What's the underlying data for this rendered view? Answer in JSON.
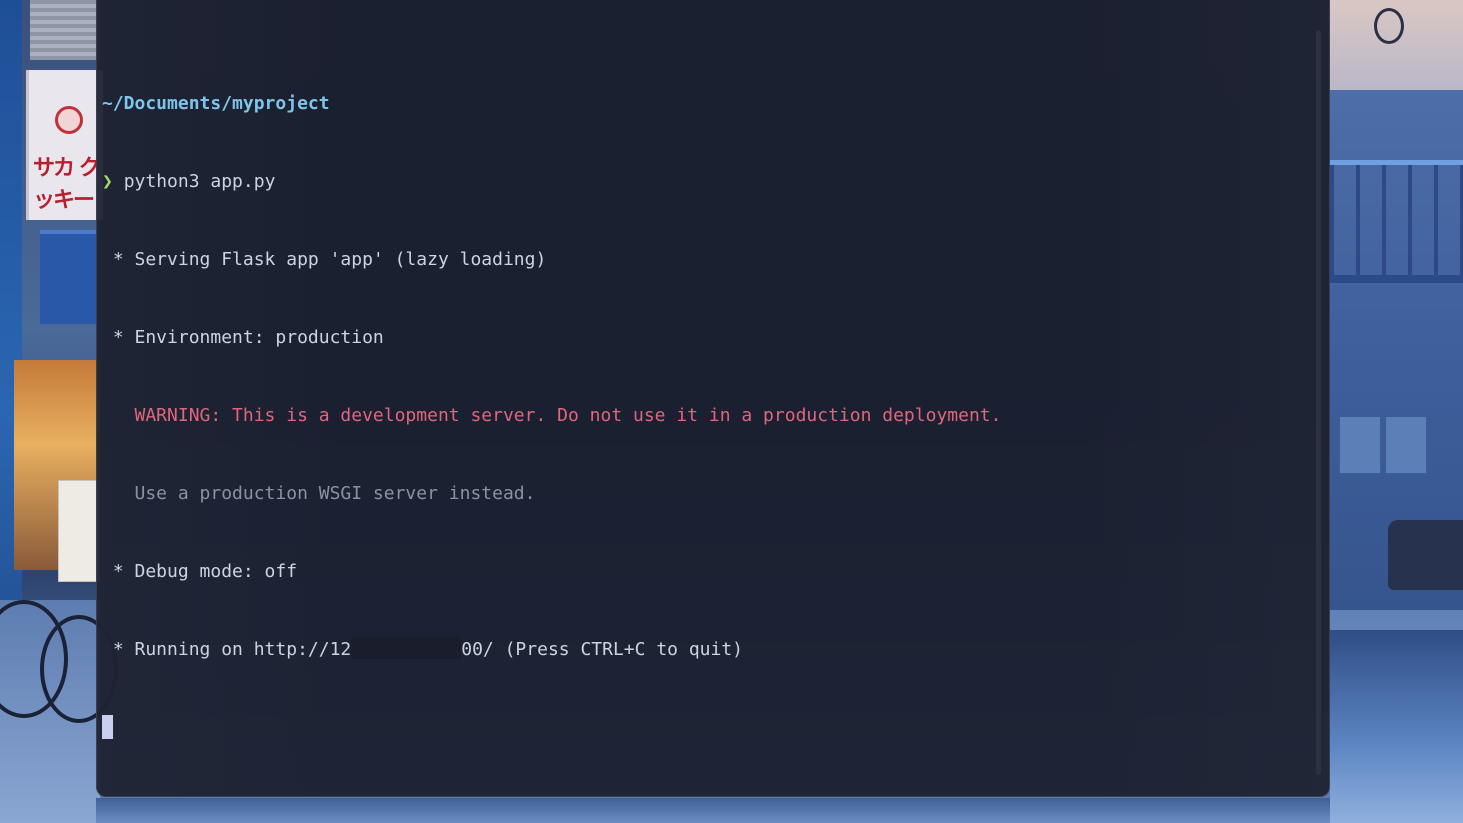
{
  "terminal": {
    "cwd": "~/Documents/myproject",
    "prompt_symbol": "❯",
    "command": "python3 app.py",
    "output": {
      "serving": " * Serving Flask app 'app' (lazy loading)",
      "environment": " * Environment: production",
      "warning": "   WARNING: This is a development server. Do not use it in a production deployment.",
      "wsgi_hint": "   Use a production WSGI server instead.",
      "debug": " * Debug mode: off",
      "running_prefix": " * Running on http://12",
      "running_suffix": "00/ (Press CTRL+C to quit)"
    }
  },
  "colors": {
    "cwd": "#7fc4ea",
    "prompt": "#a6d86a",
    "warning": "#e0667a",
    "text": "#cdd3e3",
    "dim": "#8c92a4",
    "background": "#1a1e2c"
  },
  "wallpaper": {
    "left_sign_text": "サカ クッキー"
  }
}
